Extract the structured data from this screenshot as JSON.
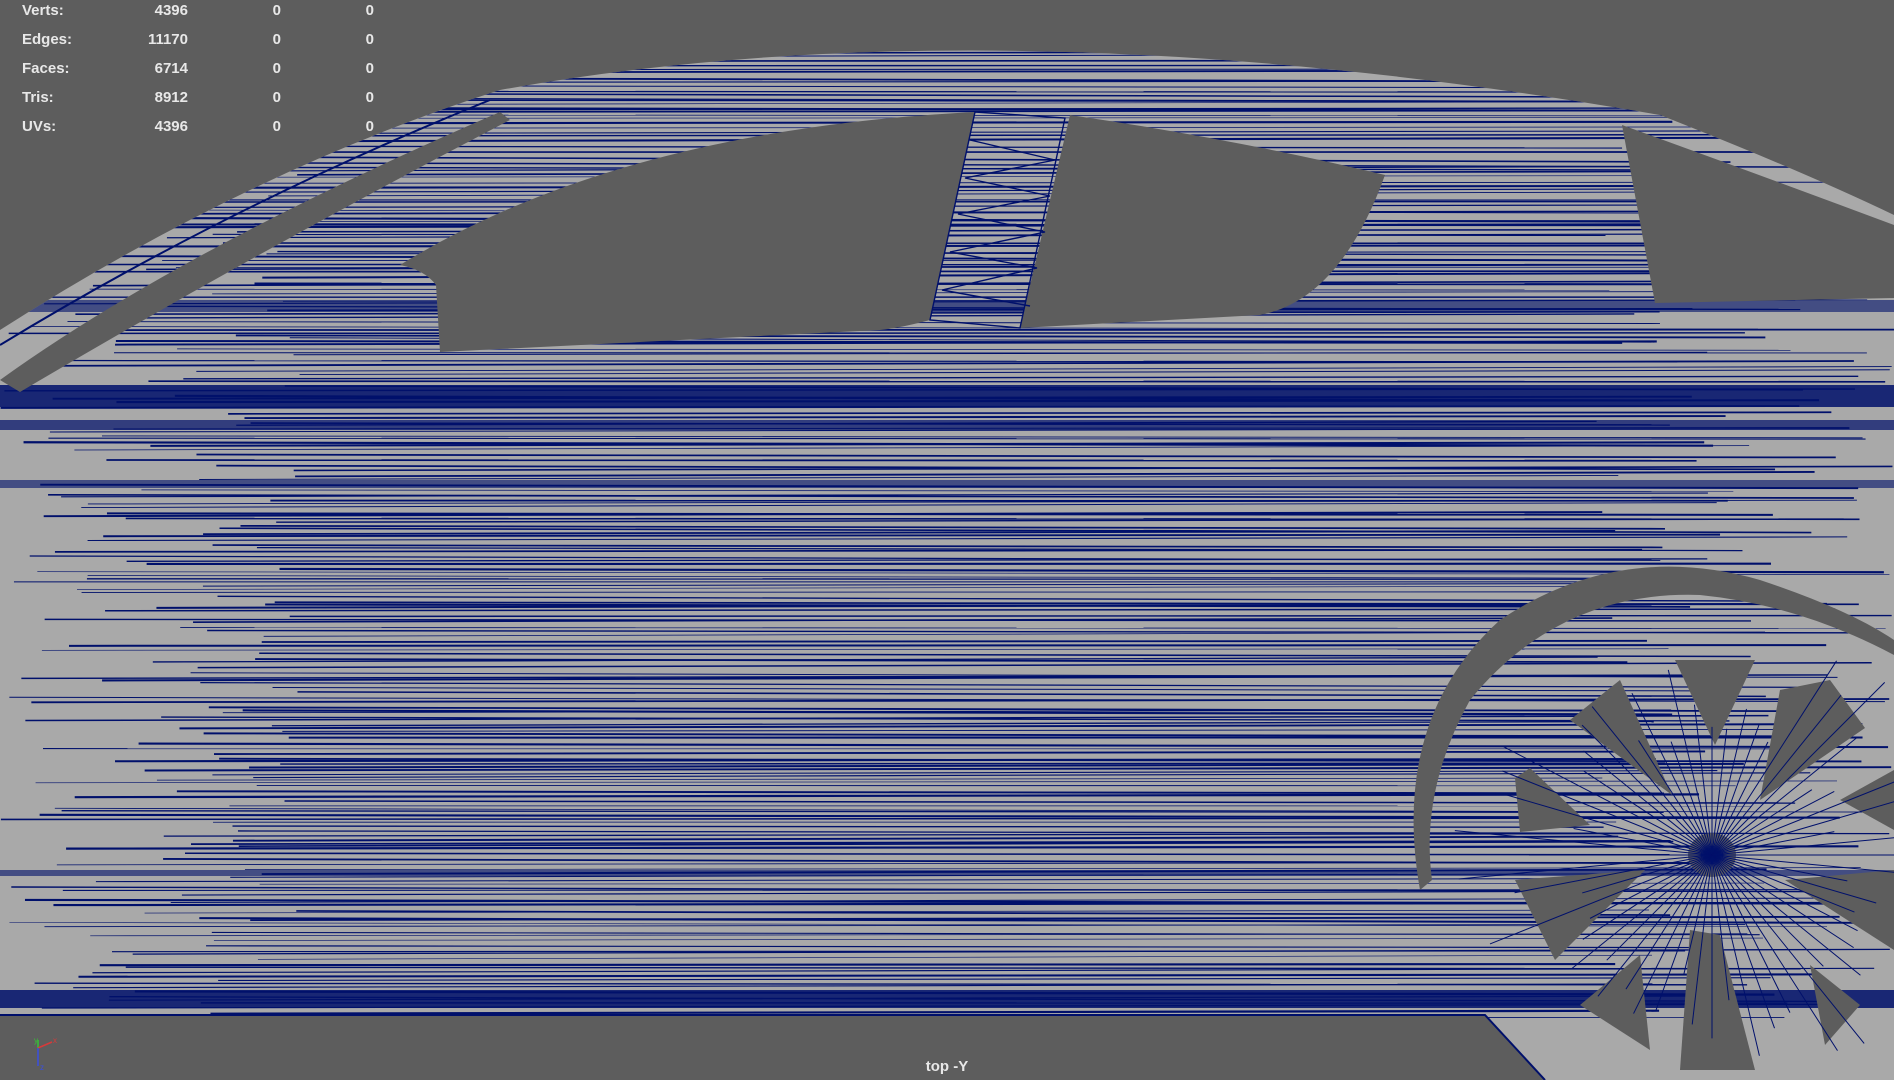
{
  "stats": {
    "rows": [
      {
        "label": "Verts:",
        "values": [
          "4396",
          "0",
          "0"
        ]
      },
      {
        "label": "Edges:",
        "values": [
          "11170",
          "0",
          "0"
        ]
      },
      {
        "label": "Faces:",
        "values": [
          "6714",
          "0",
          "0"
        ]
      },
      {
        "label": "Tris:",
        "values": [
          "8912",
          "0",
          "0"
        ]
      },
      {
        "label": "UVs:",
        "values": [
          "4396",
          "0",
          "0"
        ]
      }
    ]
  },
  "viewport": {
    "camera_label": "top -Y",
    "axis_labels": {
      "y": "y",
      "x": "x",
      "z": "z"
    },
    "colors": {
      "background": "#5d5d5d",
      "surface": "#a9a9a9",
      "wire": "#00106b",
      "hud_text": "#e8e8e8",
      "axis_x": "#d63a3a",
      "axis_y": "#36c236",
      "axis_z": "#3a4fe0"
    },
    "object": "car-side-mesh"
  }
}
